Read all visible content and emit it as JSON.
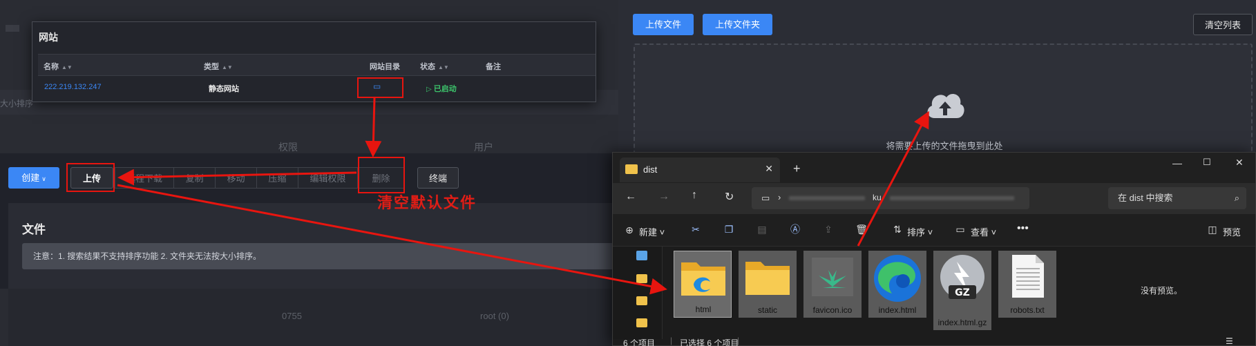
{
  "background": {
    "left_ghost": [
      "大小排序",
      "权限",
      "用户",
      "0755",
      "root (0)"
    ]
  },
  "site_card": {
    "title": "网站",
    "columns": [
      "名称",
      "类型",
      "网站目录",
      "状态",
      "备注"
    ],
    "row": {
      "name": "222.219.132.247",
      "type": "静态网站",
      "status": "已启动"
    }
  },
  "toolbar": {
    "create": "创建",
    "upload": "上传",
    "group": [
      "远程下载",
      "复制",
      "移动",
      "压缩",
      "编辑权限",
      "删除"
    ],
    "terminal": "终端"
  },
  "files": {
    "title": "文件",
    "notice": "注意：1. 搜索结果不支持排序功能 2. 文件夹无法按大小排序。"
  },
  "upload_panel": {
    "upload_file": "上传文件",
    "upload_folder": "上传文件夹",
    "clear_list": "清空列表",
    "drop_hint": "将需要上传的文件拖曳到此处"
  },
  "explorer": {
    "tab_title": "dist",
    "address_fragment": "ku",
    "search_placeholder": "在 dist 中搜索",
    "commands": {
      "new": "新建",
      "sort": "排序",
      "view": "查看",
      "preview": "预览"
    },
    "items": [
      {
        "label": "html",
        "icon": "folder-html-icon"
      },
      {
        "label": "static",
        "icon": "folder-icon"
      },
      {
        "label": "favicon.ico",
        "icon": "favicon-icon"
      },
      {
        "label": "index.html",
        "icon": "edge-html-icon"
      },
      {
        "label": "index.html.gz",
        "icon": "gz-archive-icon"
      },
      {
        "label": "robots.txt",
        "icon": "text-file-icon"
      }
    ],
    "no_preview": "没有预览。",
    "status_count": "6 个项目",
    "status_selected": "已选择 6 个项目"
  },
  "annotation": {
    "text": "清空默认文件",
    "color": "#e01d16"
  }
}
